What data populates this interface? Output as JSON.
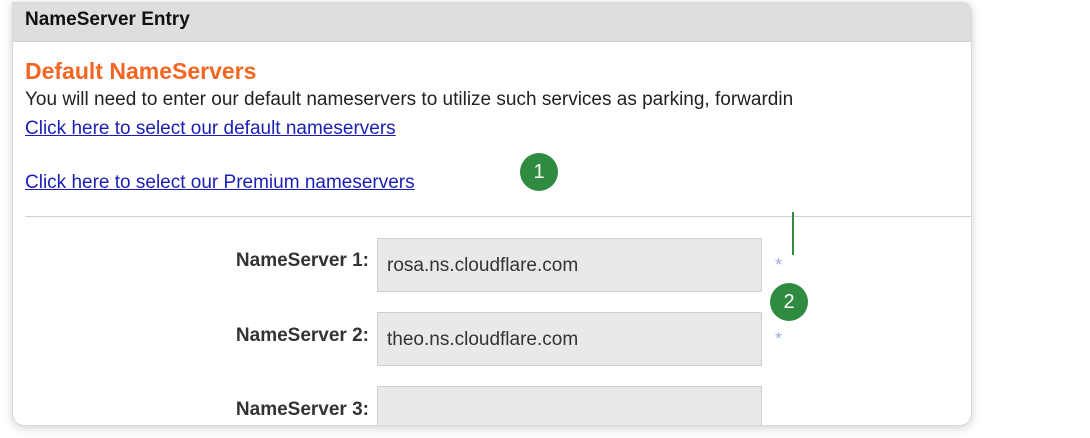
{
  "panel": {
    "title": "NameServer Entry"
  },
  "default_nameservers": {
    "heading": "Default NameServers",
    "description": "You will need to enter our default nameservers to utilize such services as parking, forwardin",
    "default_link": "Click here to select our default nameservers",
    "premium_link": "Click here to select our Premium nameservers"
  },
  "nameservers": [
    {
      "label": "NameServer 1:",
      "value": "rosa.ns.cloudflare.com",
      "required_marker": "*"
    },
    {
      "label": "NameServer 2:",
      "value": "theo.ns.cloudflare.com",
      "required_marker": "*"
    },
    {
      "label": "NameServer 3:",
      "value": ""
    }
  ],
  "annotations": {
    "step_1": "1",
    "step_2": "2",
    "color": "#2e8b3f"
  },
  "colors": {
    "heading": "#f26522",
    "link": "#1a1fb4",
    "header_bg": "#dedede",
    "input_bg": "#e9e9e9"
  }
}
